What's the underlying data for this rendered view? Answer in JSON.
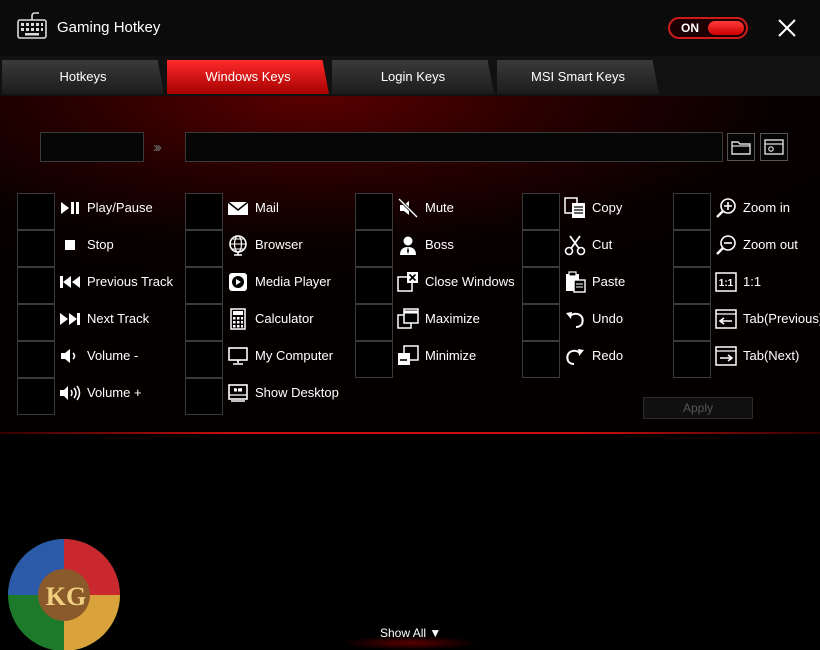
{
  "app": {
    "title": "Gaming Hotkey",
    "toggle_label": "ON"
  },
  "tabs": [
    {
      "label": "Hotkeys",
      "active": false
    },
    {
      "label": "Windows Keys",
      "active": true
    },
    {
      "label": "Login Keys",
      "active": false
    },
    {
      "label": "MSI Smart Keys",
      "active": false
    }
  ],
  "editor": {
    "key_value": "",
    "path_value": "",
    "arrows": "›››"
  },
  "columns": [
    {
      "items": [
        {
          "label": "Play/Pause",
          "icon": "play-pause-icon"
        },
        {
          "label": "Stop",
          "icon": "stop-icon"
        },
        {
          "label": "Previous Track",
          "icon": "previous-track-icon"
        },
        {
          "label": "Next Track",
          "icon": "next-track-icon"
        },
        {
          "label": "Volume -",
          "icon": "volume-down-icon"
        },
        {
          "label": "Volume +",
          "icon": "volume-up-icon"
        }
      ]
    },
    {
      "items": [
        {
          "label": "Mail",
          "icon": "mail-icon"
        },
        {
          "label": "Browser",
          "icon": "globe-icon"
        },
        {
          "label": "Media Player",
          "icon": "media-player-icon"
        },
        {
          "label": "Calculator",
          "icon": "calculator-icon"
        },
        {
          "label": "My Computer",
          "icon": "computer-icon"
        },
        {
          "label": "Show Desktop",
          "icon": "desktop-icon"
        }
      ]
    },
    {
      "items": [
        {
          "label": "Mute",
          "icon": "mute-icon"
        },
        {
          "label": "Boss",
          "icon": "boss-icon"
        },
        {
          "label": "Close Windows",
          "icon": "close-window-icon"
        },
        {
          "label": "Maximize",
          "icon": "maximize-icon"
        },
        {
          "label": "Minimize",
          "icon": "minimize-icon"
        }
      ]
    },
    {
      "items": [
        {
          "label": "Copy",
          "icon": "copy-icon"
        },
        {
          "label": "Cut",
          "icon": "scissors-icon"
        },
        {
          "label": "Paste",
          "icon": "paste-icon"
        },
        {
          "label": "Undo",
          "icon": "undo-icon"
        },
        {
          "label": "Redo",
          "icon": "redo-icon"
        }
      ]
    },
    {
      "items": [
        {
          "label": "Zoom in",
          "icon": "zoom-in-icon"
        },
        {
          "label": "Zoom out",
          "icon": "zoom-out-icon"
        },
        {
          "label": "1:1",
          "icon": "actual-size-icon"
        },
        {
          "label": "Tab(Previous)",
          "icon": "tab-previous-icon"
        },
        {
          "label": "Tab(Next)",
          "icon": "tab-next-icon"
        }
      ]
    }
  ],
  "apply_label": "Apply",
  "watermark": "KG",
  "show_all_label": "Show All ▼",
  "colors": {
    "accent": "#d01b1b",
    "background": "#000000"
  }
}
